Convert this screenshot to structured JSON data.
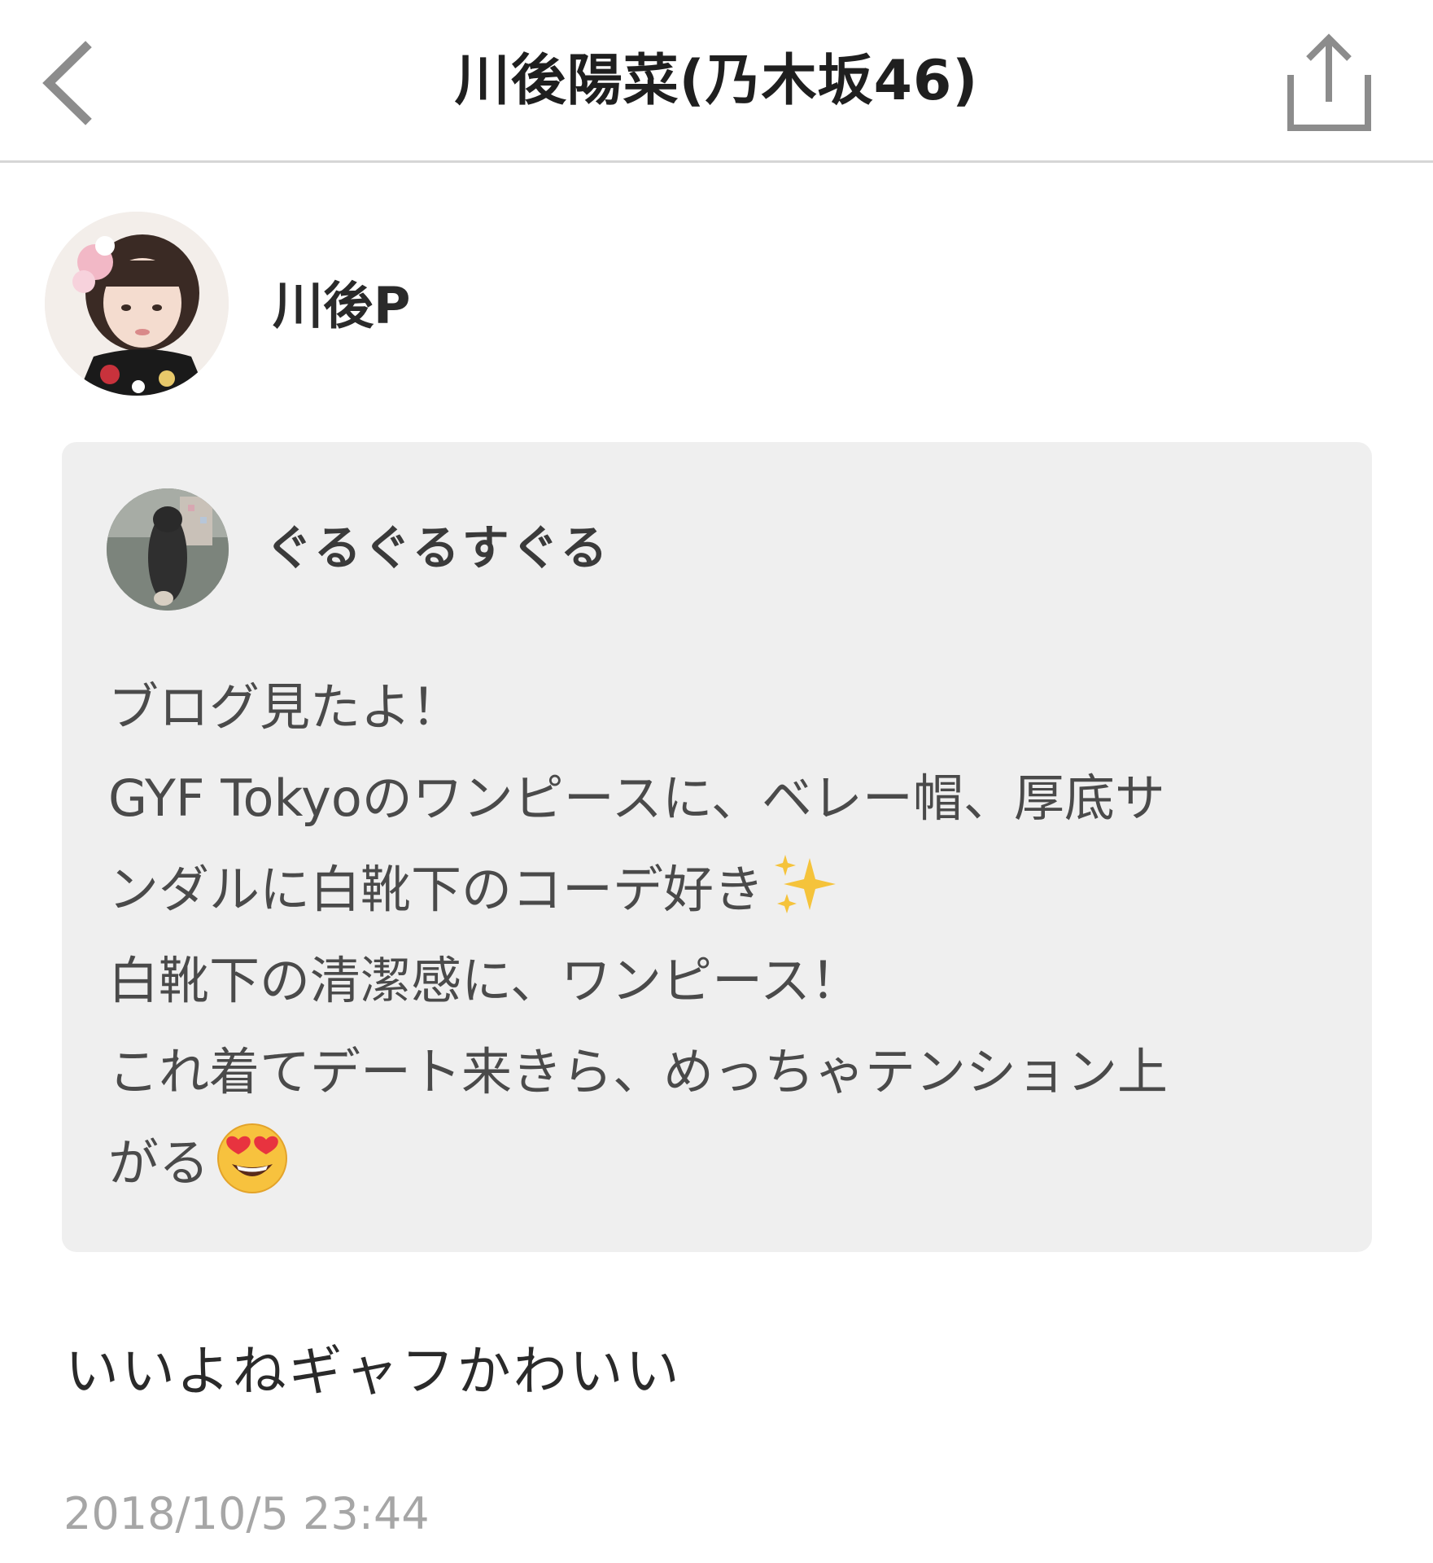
{
  "header": {
    "title": "川後陽菜(乃木坂46)",
    "back_icon": "chevron-left-icon",
    "share_icon": "share-icon"
  },
  "post": {
    "author_name": "川後P",
    "quote": {
      "user_name": "ぐるぐるすぐる",
      "lines": [
        "ブログ見たよ！",
        "GYF Tokyoのワンピースに、ベレー帽、厚底サ",
        "ンダルに白靴下のコーデ好き",
        "白靴下の清潔感に、ワンピース！",
        "これ着てデート来きら、めっちゃテンション上",
        "がる"
      ]
    },
    "comment": "いいよねギャフかわいい",
    "timestamp": "2018/10/5 23:44"
  },
  "colors": {
    "quote_background": "#efefef",
    "timestamp": "#a6a6a6",
    "icon_gray": "#8c8c8c"
  }
}
